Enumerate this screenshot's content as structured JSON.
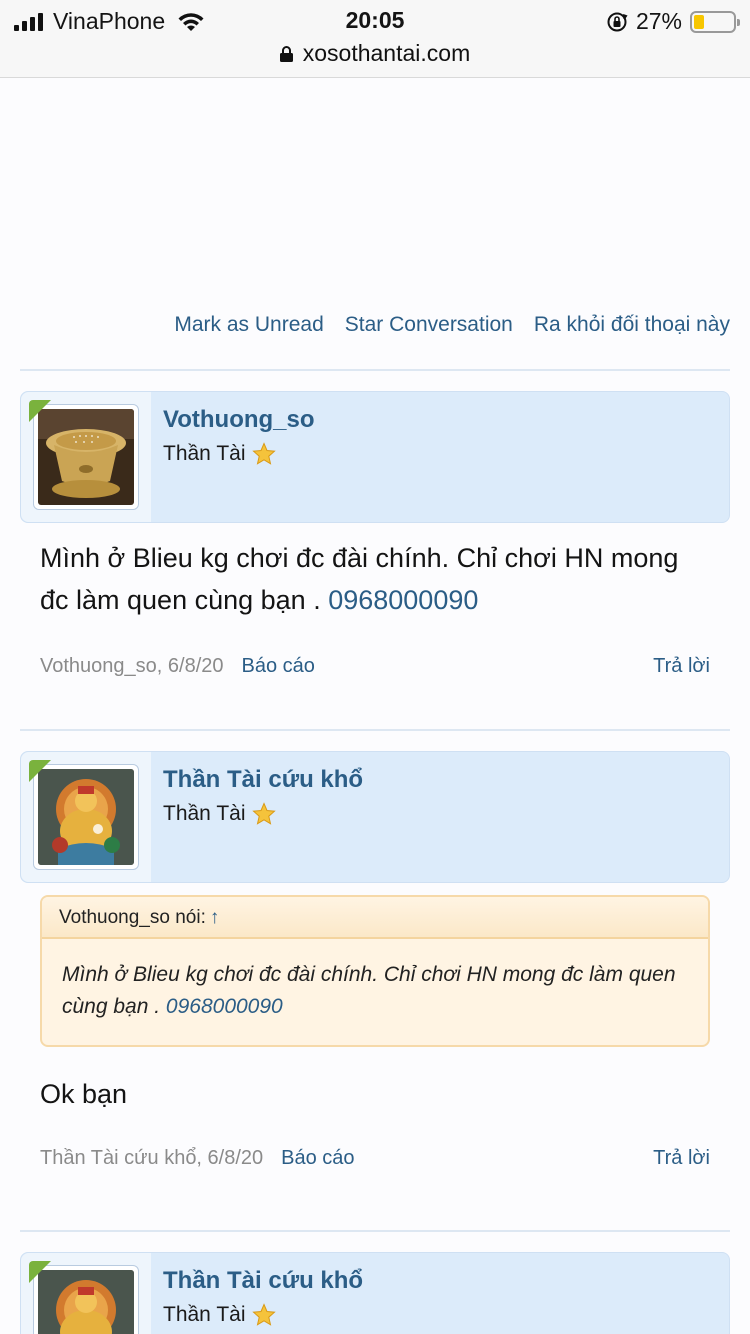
{
  "status_bar": {
    "carrier": "VinaPhone",
    "time": "20:05",
    "battery_pct": "27%",
    "battery_level": 0.27,
    "url": "xosothantai.com"
  },
  "conversation_actions": {
    "mark_unread": "Mark as Unread",
    "star": "Star Conversation",
    "leave": "Ra khỏi đối thoại này"
  },
  "messages": [
    {
      "username": "Vothuong_so",
      "user_title": "Thần Tài",
      "avatar": "coffee-filter",
      "text_before_link": "Mình ở Blieu kg chơi đc đài chính. Chỉ chơi HN mong đc làm quen cùng bạn . ",
      "text_link": "0968000090",
      "meta_author": "Vothuong_so, 6/8/20",
      "report": "Báo cáo",
      "reply": "Trả lời"
    },
    {
      "username": "Thần Tài cứu khổ",
      "user_title": "Thần Tài",
      "avatar": "buddha-painting",
      "quote_author": "Vothuong_so nói:",
      "quote_arrow": "↑",
      "quote_text": "Mình ở Blieu kg chơi đc đài chính. Chỉ chơi HN mong đc làm quen cùng bạn . ",
      "quote_link": "0968000090",
      "text": "Ok bạn",
      "meta_author": "Thần Tài cứu khổ, 6/8/20",
      "report": "Báo cáo",
      "reply": "Trả lời"
    },
    {
      "username": "Thần Tài cứu khổ",
      "user_title": "Thần Tài",
      "avatar": "buddha-painting"
    }
  ],
  "colors": {
    "link": "#2b5d86",
    "user_block_bg": "#dcebfa",
    "quote_bg": "#fff4e3",
    "online_indicator": "#7ab23d"
  }
}
